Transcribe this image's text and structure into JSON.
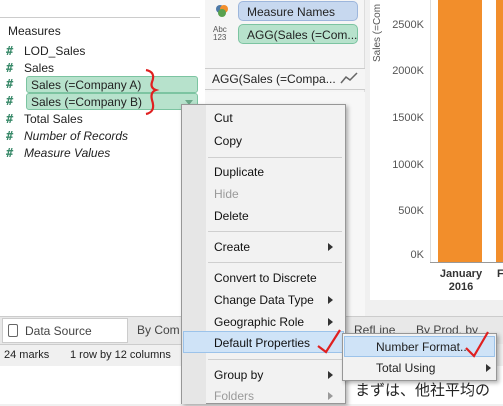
{
  "data_pane": {
    "header": "Measures",
    "fields": [
      {
        "label": "LOD_Sales"
      },
      {
        "label": "Sales"
      },
      {
        "label": "Sales (=Company A)"
      },
      {
        "label": "Sales (=Company B)"
      },
      {
        "label": "Total Sales"
      },
      {
        "label": "Number of Records"
      },
      {
        "label": "Measure Values"
      }
    ]
  },
  "marks": {
    "pill_measure_names": "Measure Names",
    "pill_agg": "AGG(Sales (=Com...",
    "abc_label_top": "Abc",
    "abc_label_bottom": "123",
    "agg_row": "AGG(Sales (=Compa..."
  },
  "chart": {
    "y_axis_title": "Sales (=Com",
    "x_label": "January",
    "x_year": "2016",
    "x_next": "F",
    "colors": {
      "bar": "#f28e2b"
    }
  },
  "chart_data": {
    "type": "bar",
    "categories": [
      "January 2016"
    ],
    "values": [
      2800
    ],
    "ylabel": "Sales (=Com",
    "yticks": [
      "2500K",
      "2000K",
      "1500K",
      "1000K",
      "500K",
      "0K"
    ],
    "ylim": [
      0,
      2800
    ]
  },
  "tabs": {
    "data_source": "Data Source",
    "by_comp": "By Com",
    "ref_line": "RefLine",
    "by_prod": "By Prod, by Com"
  },
  "status": {
    "marks": "24 marks",
    "rows": "1 row by 12 columns"
  },
  "context_menu": {
    "items": [
      {
        "label": "Cut"
      },
      {
        "label": "Copy"
      },
      {
        "label": "Duplicate"
      },
      {
        "label": "Hide"
      },
      {
        "label": "Delete"
      },
      {
        "label": "Create"
      },
      {
        "label": "Convert to Discrete"
      },
      {
        "label": "Change Data Type"
      },
      {
        "label": "Geographic Role"
      },
      {
        "label": "Default Properties"
      },
      {
        "label": "Group by"
      },
      {
        "label": "Folders"
      }
    ]
  },
  "submenu": {
    "items": [
      {
        "label": "Number Format..."
      },
      {
        "label": "Total Using"
      }
    ]
  },
  "footer_text": "まずは、他社平均の"
}
